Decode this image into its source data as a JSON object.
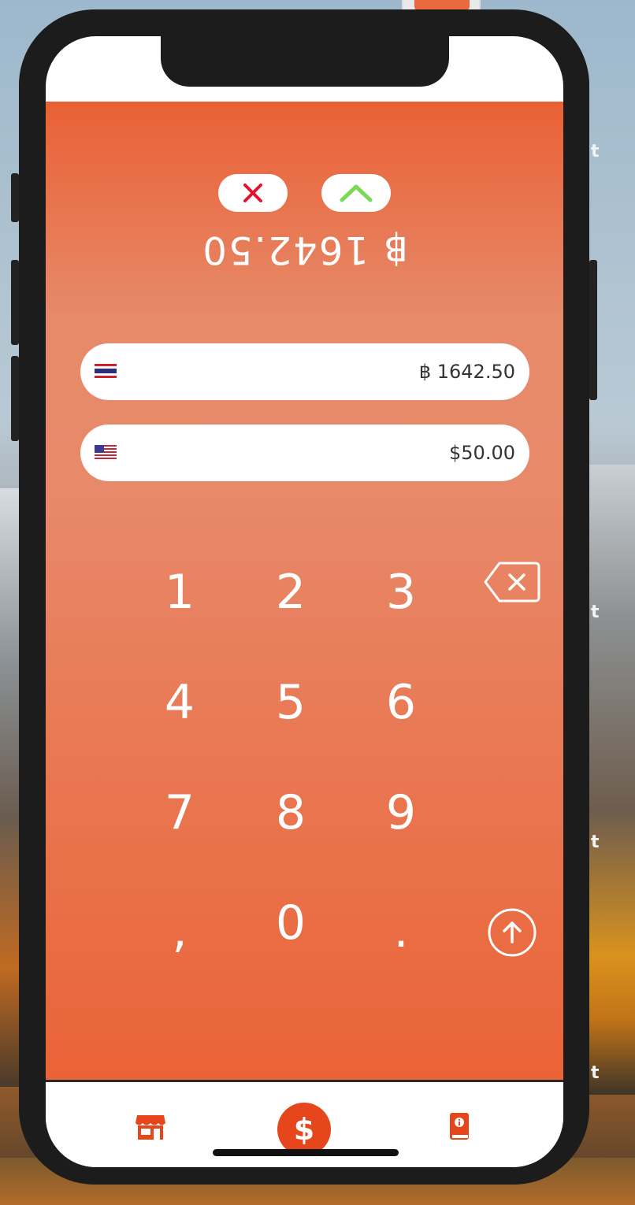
{
  "desktop": {
    "side_letters": [
      "t",
      "t",
      "t",
      "t"
    ]
  },
  "header": {
    "cancel_icon": "close-icon",
    "confirm_icon": "chevron-up-icon",
    "converted_amount": "฿ 1642.50"
  },
  "converter": {
    "fields": [
      {
        "currency": "THB",
        "flag_icon": "thailand-flag-icon",
        "value": "฿ 1642.50"
      },
      {
        "currency": "USD",
        "flag_icon": "usa-flag-icon",
        "value": "$50.00"
      }
    ]
  },
  "keypad": {
    "keys": [
      "1",
      "2",
      "3",
      "4",
      "5",
      "6",
      "7",
      "8",
      "9",
      ",",
      "0",
      "."
    ],
    "backspace_icon": "backspace-icon",
    "submit_icon": "arrow-up-circle-icon"
  },
  "tabbar": {
    "tabs": [
      {
        "icon": "store-icon"
      },
      {
        "icon": "dollar-icon",
        "label": "$"
      },
      {
        "icon": "info-book-icon"
      }
    ]
  },
  "colors": {
    "accent": "#ea6035",
    "cancel": "#e5122f",
    "confirm": "#7bd957",
    "tab_active": "#e5461c"
  }
}
